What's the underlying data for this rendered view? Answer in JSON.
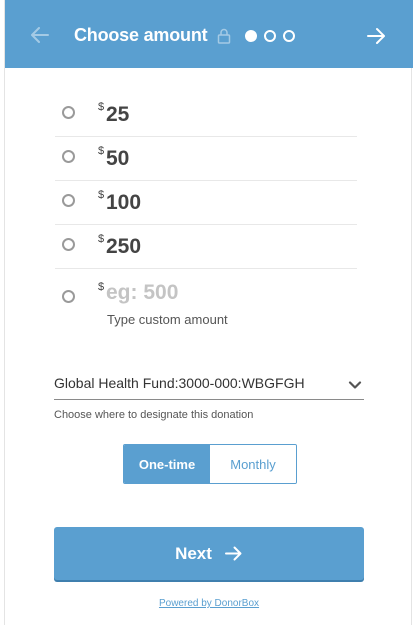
{
  "header": {
    "title": "Choose amount",
    "steps": 3,
    "active_step": 1,
    "back_icon": "arrow-left-icon",
    "forward_icon": "arrow-right-icon",
    "lock_icon": "lock-icon"
  },
  "amounts": [
    {
      "currency": "$",
      "value": "25"
    },
    {
      "currency": "$",
      "value": "50"
    },
    {
      "currency": "$",
      "value": "100"
    },
    {
      "currency": "$",
      "value": "250"
    }
  ],
  "custom": {
    "currency": "$",
    "placeholder": "eg: 500",
    "hint": "Type custom amount"
  },
  "designation": {
    "value": "Global Health Fund:3000-000:WBGFGH",
    "help": "Choose where to designate this donation"
  },
  "frequency": {
    "options": [
      "One-time",
      "Monthly"
    ],
    "selected": "One-time"
  },
  "next_button": {
    "label": "Next"
  },
  "footer": {
    "powered_by": "Powered by DonorBox"
  },
  "colors": {
    "accent": "#5a9fd0",
    "placeholder": "#c4c4c4"
  }
}
